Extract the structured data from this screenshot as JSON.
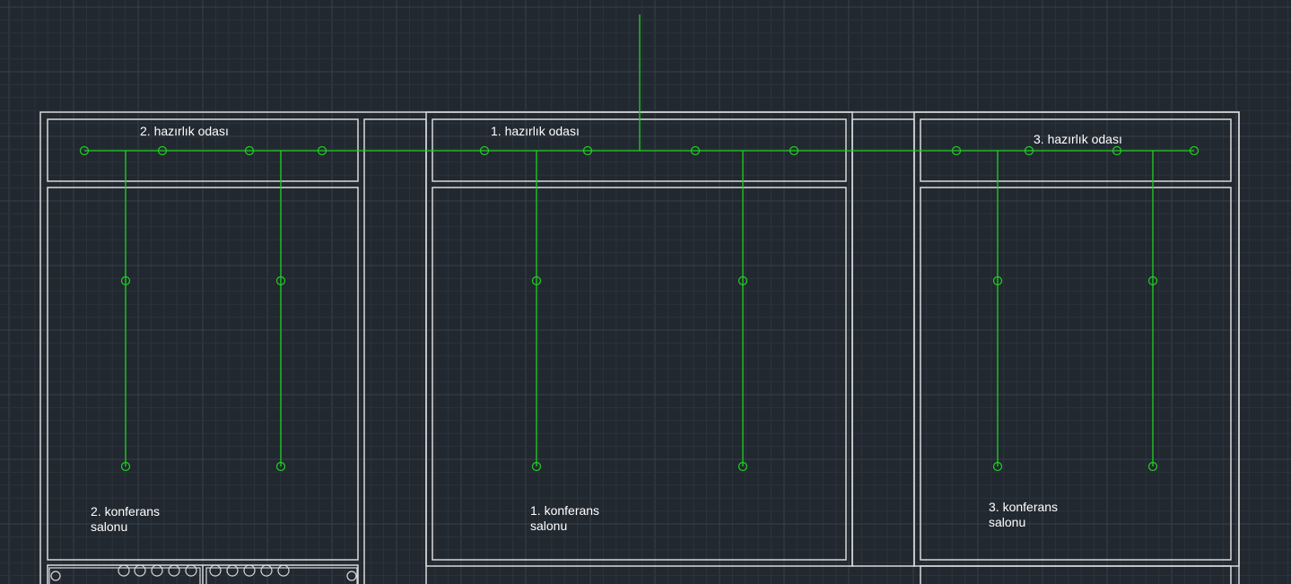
{
  "colors": {
    "background": "#212830",
    "grid_minor": "#2b333c",
    "grid_major": "#37414b",
    "walls": "#d9d9d9",
    "pipes": "#1fd21f",
    "labels": "#ffffff"
  },
  "rooms": {
    "prep_room_1": {
      "label": "1. hazırlık odası"
    },
    "prep_room_2": {
      "label": "2. hazırlık odası"
    },
    "prep_room_3": {
      "label": "3. hazırlık odası"
    },
    "conference_hall_1": {
      "line1": "1. konferans",
      "line2": "salonu"
    },
    "conference_hall_2": {
      "line1": "2. konferans",
      "line2": "salonu"
    },
    "conference_hall_3": {
      "line1": "3. konferans",
      "line2": "salonu"
    }
  }
}
